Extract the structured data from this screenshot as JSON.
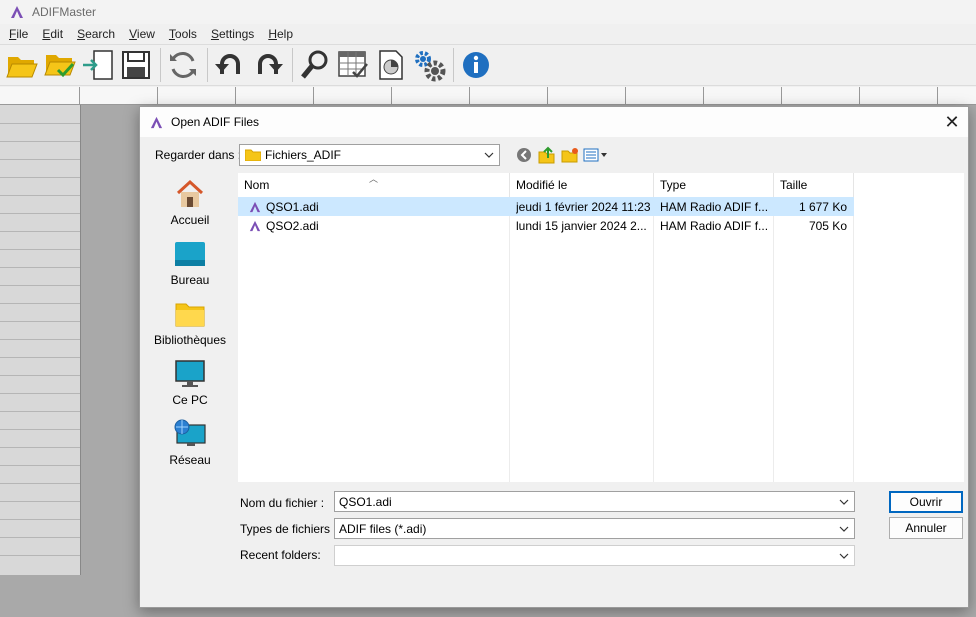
{
  "window": {
    "title": "ADIFMaster"
  },
  "menu": [
    {
      "label": "File",
      "key": "F",
      "rest": "ile"
    },
    {
      "label": "Edit",
      "key": "E",
      "rest": "dit"
    },
    {
      "label": "Search",
      "key": "S",
      "rest": "earch"
    },
    {
      "label": "View",
      "key": "V",
      "rest": "iew"
    },
    {
      "label": "Tools",
      "key": "T",
      "rest": "ools"
    },
    {
      "label": "Settings",
      "key": "S",
      "rest": "ettings"
    },
    {
      "label": "Help",
      "key": "H",
      "rest": "elp"
    }
  ],
  "toolbar": [
    "open-folder-icon",
    "open-checked-icon",
    "import-icon",
    "save-icon",
    "refresh-icon",
    "undo-icon",
    "redo-icon",
    "search-icon",
    "table-check-icon",
    "report-icon",
    "settings-gears-icon",
    "info-icon"
  ],
  "dialog": {
    "title": "Open ADIF Files",
    "look_in_label": "Regarder dans :",
    "look_in_value": "Fichiers_ADIF",
    "places": [
      {
        "label": "Accueil",
        "icon": "home-icon"
      },
      {
        "label": "Bureau",
        "icon": "desktop-icon"
      },
      {
        "label": "Bibliothèques",
        "icon": "libraries-icon"
      },
      {
        "label": "Ce PC",
        "icon": "computer-icon"
      },
      {
        "label": "Réseau",
        "icon": "network-icon"
      }
    ],
    "columns": {
      "name": "Nom",
      "modified": "Modifié le",
      "type": "Type",
      "size": "Taille"
    },
    "files": [
      {
        "name": "QSO1.adi",
        "modified": "jeudi 1 février 2024 11:23",
        "type": "HAM Radio ADIF f...",
        "size": "1 677 Ko",
        "selected": true
      },
      {
        "name": "QSO2.adi",
        "modified": "lundi 15 janvier 2024 2...",
        "type": "HAM Radio ADIF f...",
        "size": "705 Ko",
        "selected": false
      }
    ],
    "filename_label": "Nom du fichier :",
    "filename_value": "QSO1.adi",
    "filetype_label": "Types de fichiers :",
    "filetype_value": "ADIF files (*.adi)",
    "recent_label": "Recent folders:",
    "recent_value": "",
    "open_button": "Ouvrir",
    "cancel_button": "Annuler"
  },
  "colors": {
    "accent": "#0067c0",
    "selection": "#cce8ff",
    "app_icon": "#7b4fb5"
  }
}
